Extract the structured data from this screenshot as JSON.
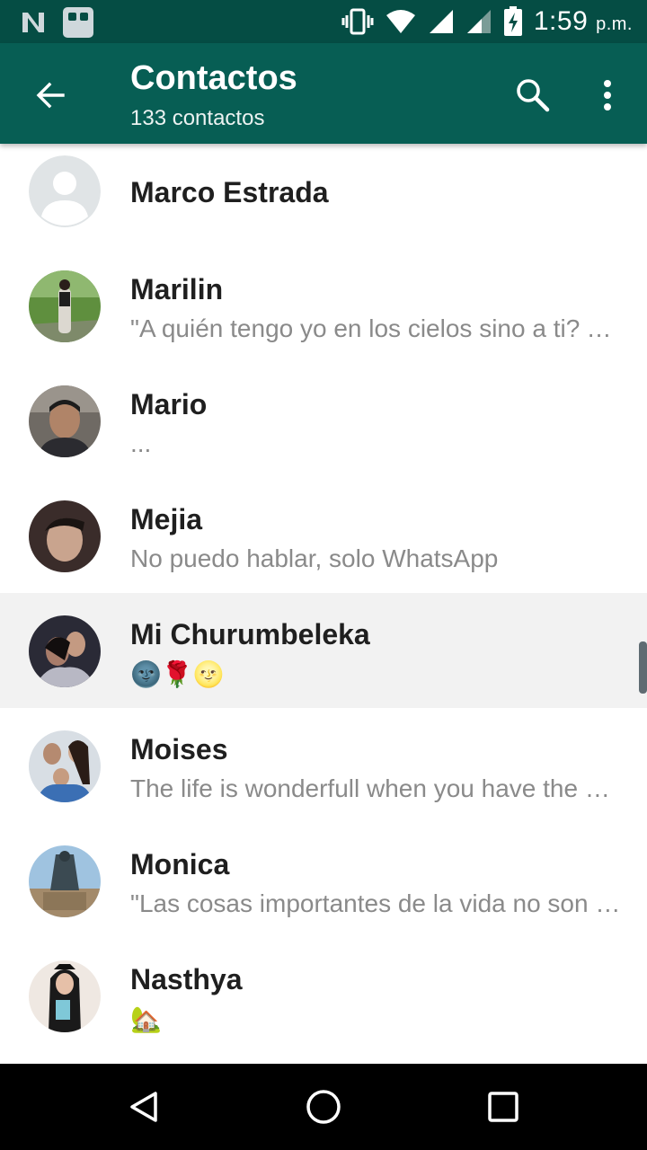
{
  "status_bar": {
    "time": "1:59",
    "ampm": "p.m.",
    "icons": [
      "n-icon",
      "app-notification-icon",
      "vibrate-icon",
      "wifi-icon",
      "signal-icon",
      "signal-icon-secondary",
      "battery-charging-icon"
    ]
  },
  "header": {
    "title": "Contactos",
    "subtitle": "133 contactos",
    "icons": [
      "back-arrow-icon",
      "search-icon",
      "more-vert-icon"
    ],
    "colors": {
      "status_bar": "#054d44",
      "app_bar": "#075e54"
    }
  },
  "contacts": [
    {
      "name": "Marco Estrada",
      "status": ""
    },
    {
      "name": "Marilin",
      "status": "\"A quién tengo yo en los cielos sino a ti? Y fuera de ti nada deseo en la tierra\""
    },
    {
      "name": "Mario",
      "status": "..."
    },
    {
      "name": "Mejia",
      "status": "No puedo hablar, solo WhatsApp"
    },
    {
      "name": "Mi Churumbeleka",
      "status": "🌚🌹🌝"
    },
    {
      "name": "Moises",
      "status": "The life is wonderfull when you have the people you love"
    },
    {
      "name": "Monica",
      "status": "\"Las cosas importantes de la vida no son cosas\""
    },
    {
      "name": "Nasthya",
      "status": "🏡"
    }
  ],
  "nav": {
    "icons": [
      "back-triangle-icon",
      "home-circle-icon",
      "recents-square-icon"
    ]
  }
}
